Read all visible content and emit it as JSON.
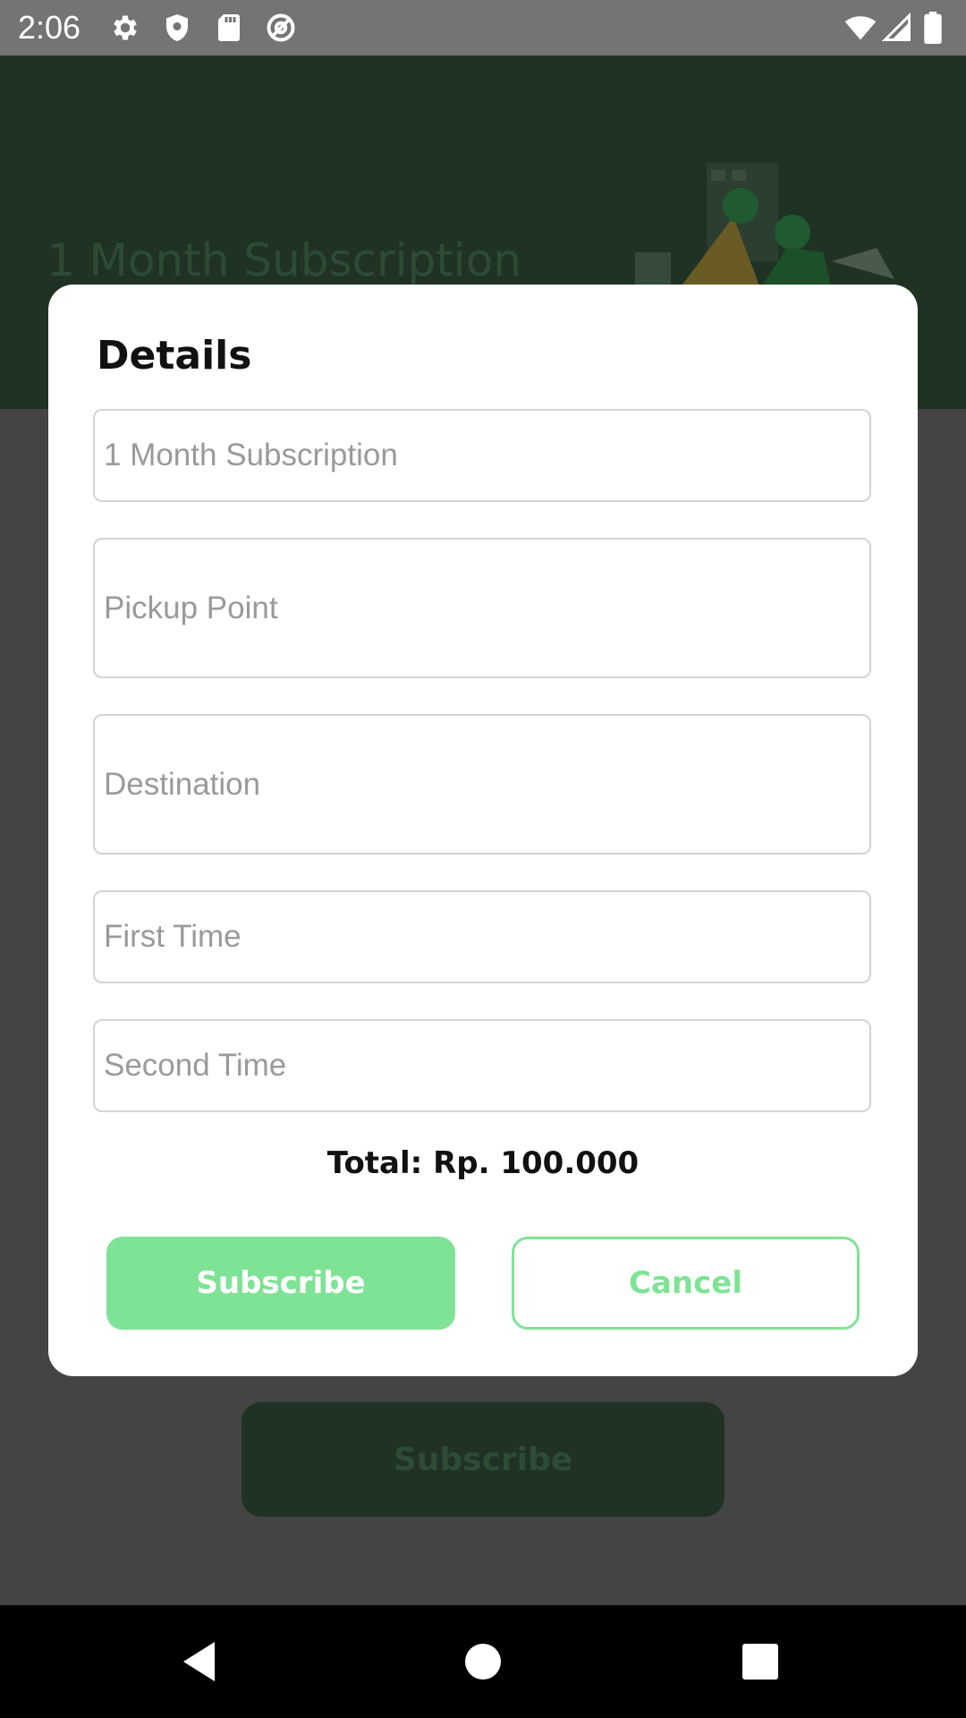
{
  "status_bar": {
    "time": "2:06",
    "left_icons": [
      "gear-icon",
      "shield-icon",
      "sd-card-icon",
      "at-sign-icon"
    ],
    "right_icons": [
      "wifi-icon",
      "signal-icon",
      "battery-icon"
    ]
  },
  "background": {
    "header_title": "1 Month Subscription",
    "subscribe_button_label": "Subscribe"
  },
  "dialog": {
    "title": "Details",
    "fields": {
      "subscription": {
        "placeholder": "1 Month Subscription"
      },
      "pickup": {
        "placeholder": "Pickup Point"
      },
      "destination": {
        "placeholder": "Destination"
      },
      "first_time": {
        "placeholder": "First Time"
      },
      "second_time": {
        "placeholder": "Second Time"
      }
    },
    "total": "Total: Rp. 100.000",
    "subscribe_label": "Subscribe",
    "cancel_label": "Cancel"
  },
  "nav_bar": {
    "icons": [
      "back-icon",
      "home-icon",
      "recents-icon"
    ]
  },
  "colors": {
    "accent": "#7fe396",
    "scrim": "#444444",
    "header_dimmed": "#203224",
    "status_bar": "#747474"
  }
}
